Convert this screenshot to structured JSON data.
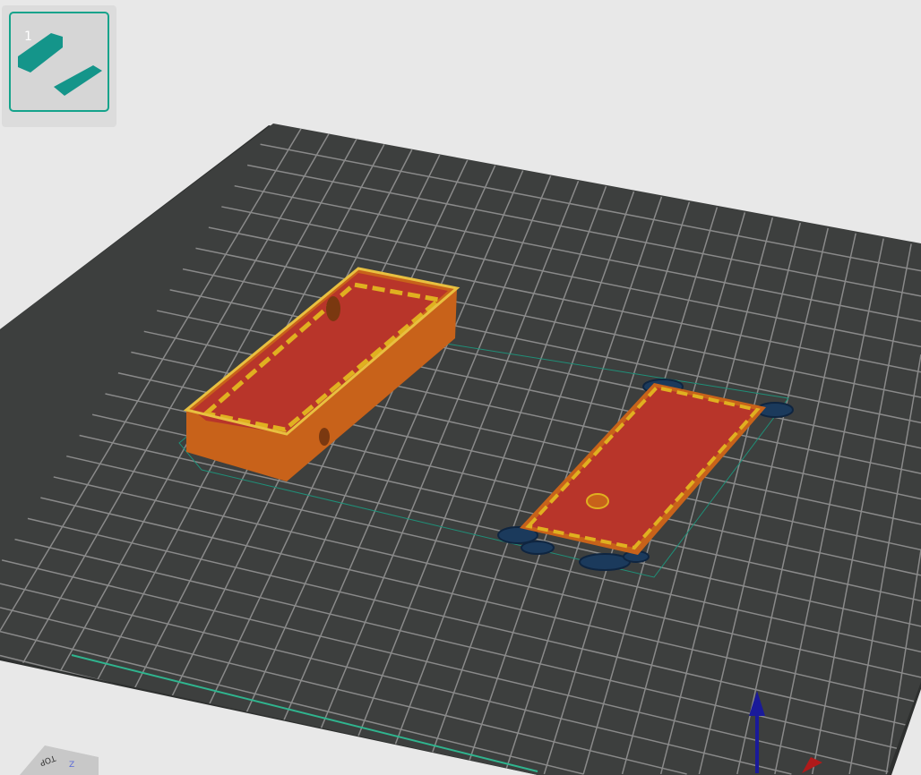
{
  "plate_list": {
    "plates": [
      {
        "number": "1"
      }
    ]
  },
  "view_cube": {
    "face_label": "TOP",
    "axis_label": "Z"
  },
  "colors": {
    "accent": "#14a38b",
    "plate": "#3d3f3e",
    "grid": "#8a8a8a",
    "filament": "#c8621a",
    "infill": "#e0b020",
    "brim": "#1b3a5c",
    "axis_z": "#1a1a9a",
    "axis_x": "#b01a1a"
  }
}
